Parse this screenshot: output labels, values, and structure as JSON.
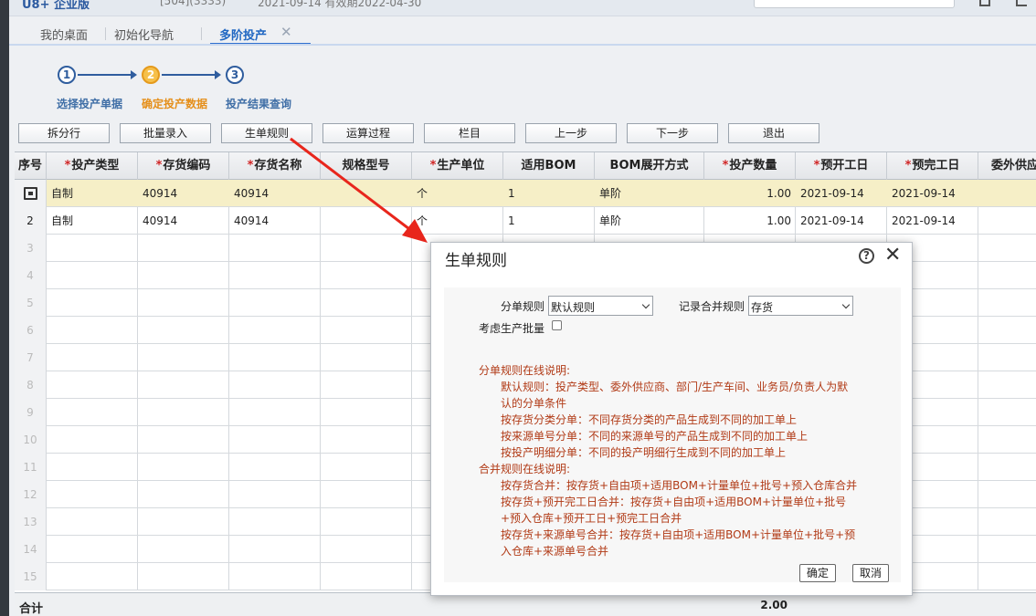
{
  "header": {
    "brand": "U8+ 企业版",
    "info1": "[504](3333)",
    "info2": "2021-09-14  有效期2022-04-30"
  },
  "tabs": [
    {
      "label": "我的桌面"
    },
    {
      "label": "初始化导航"
    },
    {
      "label": "多阶投产"
    }
  ],
  "steps": [
    {
      "num": "1",
      "label": "选择投产单据"
    },
    {
      "num": "2",
      "label": "确定投产数据"
    },
    {
      "num": "3",
      "label": "投产结果查询"
    }
  ],
  "toolbar": [
    "拆分行",
    "批量录入",
    "生单规则",
    "运算过程",
    "栏目",
    "上一步",
    "下一步",
    "退出"
  ],
  "grid": {
    "row_no_header": "序号",
    "columns": [
      {
        "label": "投产类型",
        "required": true
      },
      {
        "label": "存货编码",
        "required": true
      },
      {
        "label": "存货名称",
        "required": true
      },
      {
        "label": "规格型号",
        "required": false
      },
      {
        "label": "生产单位",
        "required": true
      },
      {
        "label": "适用BOM",
        "required": false
      },
      {
        "label": "BOM展开方式",
        "required": false
      },
      {
        "label": "投产数量",
        "required": true
      },
      {
        "label": "预开工日",
        "required": true
      },
      {
        "label": "预完工日",
        "required": true
      },
      {
        "label": "委外供应",
        "required": false
      }
    ],
    "rows": [
      {
        "no": "",
        "cells": [
          "自制",
          "40914",
          "40914",
          "",
          "个",
          "1",
          "单阶",
          "1.00",
          "2021-09-14",
          "2021-09-14",
          ""
        ]
      },
      {
        "no": "2",
        "cells": [
          "自制",
          "40914",
          "40914",
          "",
          "个",
          "1",
          "单阶",
          "1.00",
          "2021-09-14",
          "2021-09-14",
          ""
        ]
      }
    ],
    "empty_rows": [
      "3",
      "4",
      "5",
      "6",
      "7",
      "8",
      "9",
      "10",
      "11",
      "12",
      "13",
      "14",
      "15"
    ],
    "footer_label": "合计",
    "footer_qty": "2.00"
  },
  "dialog": {
    "title": "生单规则",
    "split_rule_label": "分单规则",
    "split_rule_value": "默认规则",
    "merge_rule_label": "记录合并规则",
    "merge_rule_value": "存货",
    "consider_batch_label": "考虑生产批量",
    "consider_batch_checked": false,
    "desc_lines": [
      "分单规则在线说明:",
      "默认规则：投产类型、委外供应商、部门/生产车间、业务员/负责人为默",
      "认的分单条件",
      "按存货分类分单：不同存货分类的产品生成到不同的加工单上",
      "按来源单号分单：不同的来源单号的产品生成到不同的加工单上",
      "按投产明细分单：不同的投产明细行生成到不同的加工单上",
      "合并规则在线说明:",
      "按存货合并：按存货+自由项+适用BOM+计量单位+批号+预入仓库合并",
      "按存货+预开完工日合并：按存货+自由项+适用BOM+计量单位+批号",
      "+预入仓库+预开工日+预完工日合并",
      "按存货+来源单号合并：按存货+自由项+适用BOM+计量单位+批号+预",
      "入仓库+来源单号合并"
    ],
    "ok_label": "确定",
    "cancel_label": "取消"
  }
}
